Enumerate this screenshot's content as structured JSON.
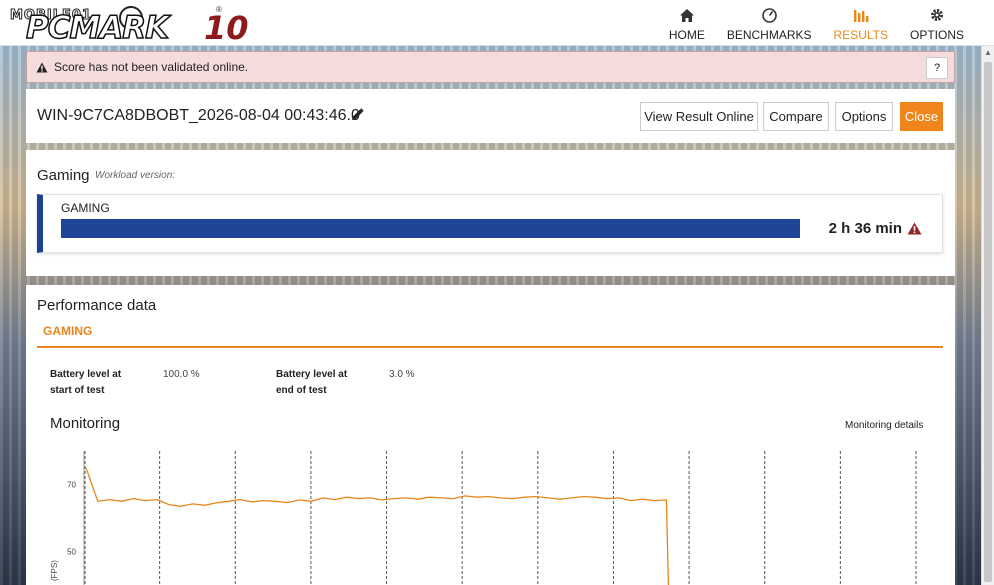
{
  "app": {
    "logo_prefix": "MOBILE01",
    "logo_name": "PCMARK",
    "logo_version": "10",
    "logo_reg": "®"
  },
  "nav": [
    {
      "label": "HOME",
      "icon": "home-icon",
      "active": false
    },
    {
      "label": "BENCHMARKS",
      "icon": "gauge-icon",
      "active": false
    },
    {
      "label": "RESULTS",
      "icon": "bar-chart-icon",
      "active": true
    },
    {
      "label": "OPTIONS",
      "icon": "gear-icon",
      "active": false
    }
  ],
  "warning": {
    "text": "Score has not been validated online.",
    "help_label": "?"
  },
  "result": {
    "title": "WIN-9C7CA8DBOBT_2026-08-04 00:43:46.0",
    "buttons": {
      "view_online": "View Result Online",
      "compare": "Compare",
      "options": "Options",
      "close": "Close"
    }
  },
  "gaming": {
    "section_title": "Gaming",
    "workload_version": "Workload version:",
    "score_label": "GAMING",
    "score_value": "2 h 36 min",
    "bar_fill": 1.0
  },
  "performance": {
    "title": "Performance data",
    "tab": "GAMING",
    "battery_start_label_1": "Battery level at",
    "battery_start_label_2": "start of test",
    "battery_start_value": "100.0 %",
    "battery_end_label_1": "Battery level at",
    "battery_end_label_2": "end of test",
    "battery_end_value": "3.0 %"
  },
  "monitoring": {
    "title": "Monitoring",
    "details_link": "Monitoring details"
  },
  "chart_data": {
    "type": "line",
    "ylabel": "FPS",
    "ytick_labels": [
      "70",
      "50"
    ],
    "segments": 11,
    "series": [
      {
        "color": "#e8861b",
        "values": [
          75,
          65,
          65.5,
          65,
          65.8,
          65.2,
          65.5,
          64,
          63.5,
          64.2,
          63.8,
          64.5,
          65,
          65.5,
          64.8,
          65.2,
          65,
          64.6,
          65.4,
          65,
          66,
          65.5,
          66.2,
          65.8,
          66,
          65.4,
          65.8,
          66,
          65.6,
          66.2,
          66,
          65.8,
          66.6,
          66.2,
          66.4,
          66,
          65.8,
          66.2,
          66.4,
          66,
          65.6,
          66,
          66.4,
          66.2,
          65.8,
          66,
          65.2,
          65.6,
          65.2,
          65.4,
          40
        ]
      }
    ],
    "colors": {
      "line": "#e8861b",
      "grid": "#555555"
    }
  }
}
